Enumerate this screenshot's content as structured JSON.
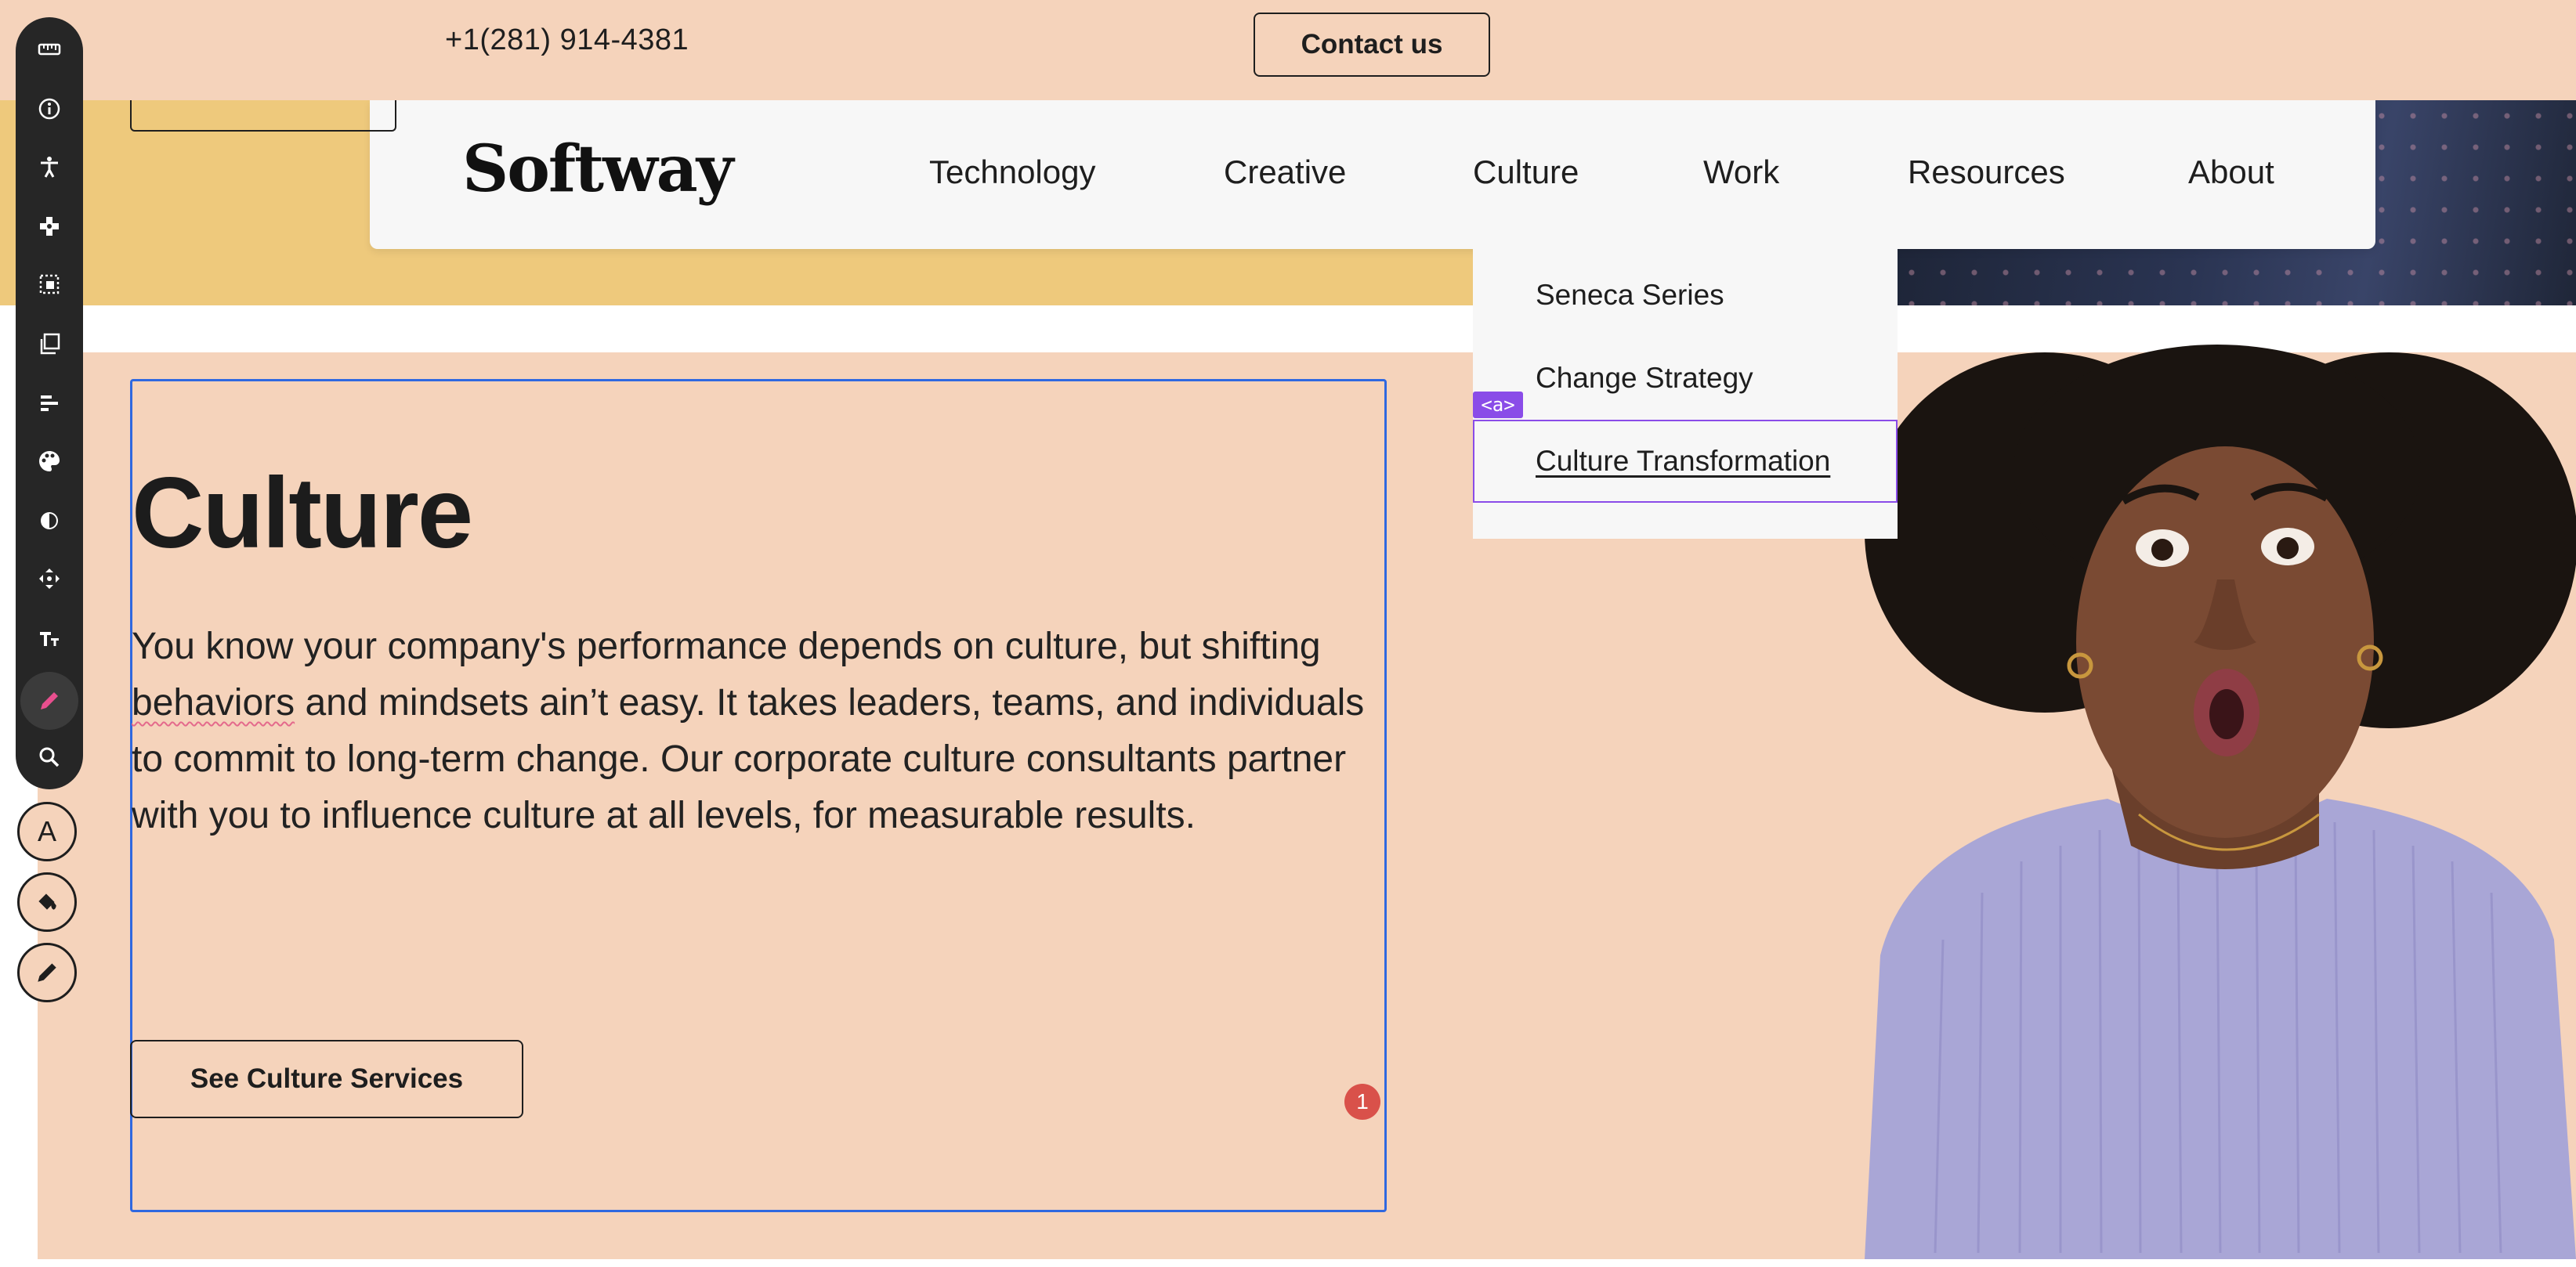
{
  "topbar": {
    "phone": "+1(281) 914-4381",
    "contact_label": "Contact us"
  },
  "header": {
    "logo": "Softway",
    "nav": [
      "Technology",
      "Creative",
      "Culture",
      "Work",
      "Resources",
      "About"
    ]
  },
  "dropdown": {
    "items": [
      "Seneca Series",
      "Change Strategy",
      "Culture Transformation"
    ],
    "selected_tag": "<a>"
  },
  "main": {
    "title": "Culture",
    "para_start": "You know your company's performance depends on culture, but shifting ",
    "para_flagged": "behaviors",
    "para_end": " and mindsets ain’t easy. It takes leaders, teams, and individuals to commit to long-term change. Our corporate culture consultants partner with you to influence culture at all levels, for measurable results.",
    "cta_label": "See Culture Services",
    "issue_count": "1"
  },
  "toolbar": {
    "icons": [
      "ruler-icon",
      "info-icon",
      "accessibility-icon",
      "gamepad-icon",
      "select-area-icon",
      "copy-icon",
      "align-icon",
      "palette-icon",
      "contrast-icon",
      "move-icon",
      "text-size-icon",
      "pencil-icon",
      "search-icon"
    ],
    "round_tools": [
      "A"
    ]
  },
  "colors": {
    "peach": "#f5d3bb",
    "yellow": "#eec97c",
    "header": "#f7f7f7",
    "selection_blue": "#2f68e0",
    "selection_purple": "#8a4ce8",
    "badge_red": "#d9514a"
  }
}
